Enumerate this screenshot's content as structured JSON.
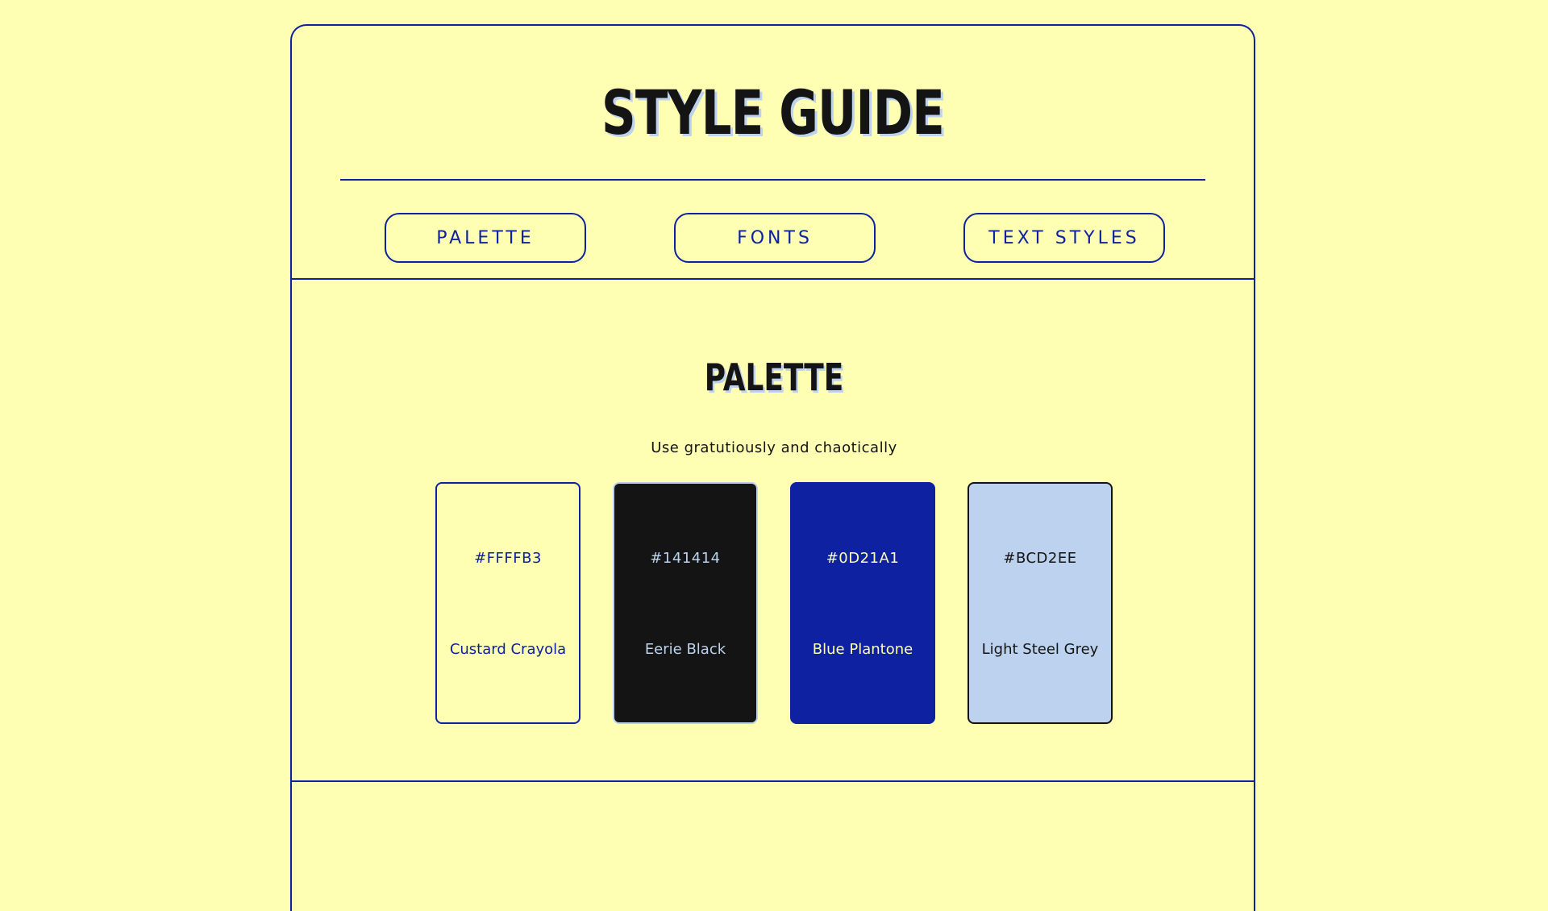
{
  "header": {
    "title": "STYLE GUIDE"
  },
  "nav": {
    "items": [
      {
        "label": "PALETTE"
      },
      {
        "label": "FONTS"
      },
      {
        "label": "TEXT STYLES"
      }
    ]
  },
  "palette_section": {
    "title": "PALETTE",
    "subtitle": "Use gratutiously and chaotically",
    "swatches": [
      {
        "hex": "#FFFFB3",
        "name": "Custard Crayola",
        "bg": "#FFFFB3",
        "text_color": "#0D21A1",
        "border_color": "#0D21A1"
      },
      {
        "hex": "#141414",
        "name": "Eerie Black",
        "bg": "#141414",
        "text_color": "#BCD2EE",
        "border_color": "#BCD2EE"
      },
      {
        "hex": "#0D21A1",
        "name": "Blue Plantone",
        "bg": "#0D21A1",
        "text_color": "#FFFFB3",
        "border_color": "#0D21A1"
      },
      {
        "hex": "#BCD2EE",
        "name": "Light Steel Grey",
        "bg": "#BCD2EE",
        "text_color": "#141414",
        "border_color": "#141414"
      }
    ]
  },
  "colors": {
    "background": "#FFFFB3",
    "accent": "#0D21A1",
    "ink": "#141414",
    "shadow": "#BCD2EE"
  }
}
